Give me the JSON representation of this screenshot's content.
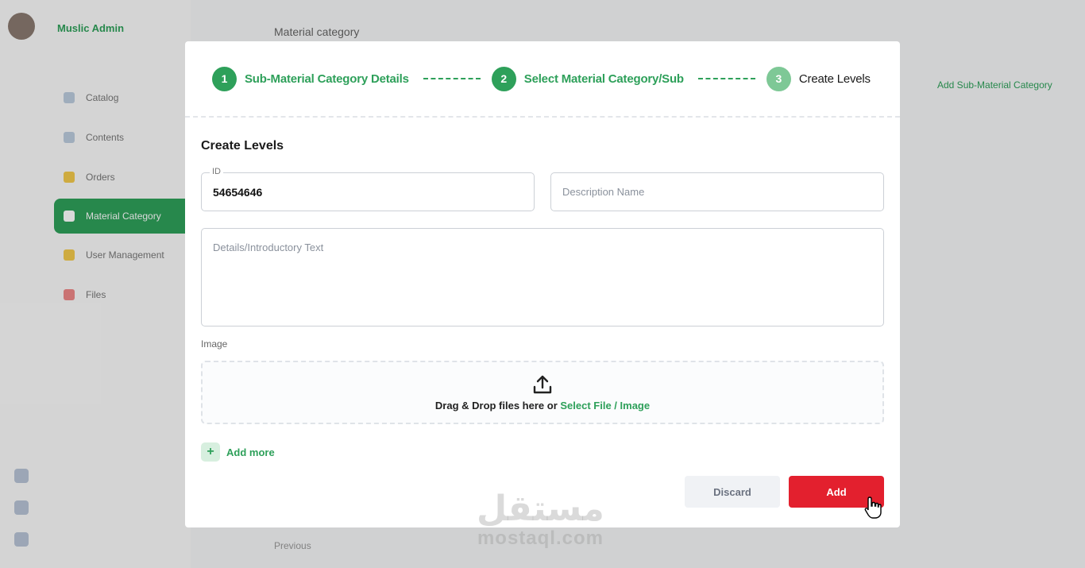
{
  "background": {
    "brand": "Muslic Admin",
    "page_title": "Material category",
    "nav_items": [
      "Catalog",
      "Contents",
      "Orders",
      "Material Category",
      "User Management",
      "Files"
    ],
    "right_link": "Add Sub-Material Category",
    "bottom_text": "Previous"
  },
  "stepper": {
    "steps": [
      {
        "num": "1",
        "label": "Sub-Material Category Details"
      },
      {
        "num": "2",
        "label": "Select Material Category/Sub"
      },
      {
        "num": "3",
        "label": "Create Levels"
      }
    ]
  },
  "form": {
    "section_title": "Create Levels",
    "id_label": "ID",
    "id_value": "54654646",
    "description_placeholder": "Description Name",
    "details_placeholder": "Details/Introductory Text",
    "image_label": "Image",
    "dropzone_text": "Drag & Drop files here or",
    "dropzone_link": "Select File / Image",
    "add_more_label": "Add more"
  },
  "actions": {
    "discard_label": "Discard",
    "add_label": "Add"
  },
  "watermark": {
    "arabic": "مستقل",
    "latin": "mostaql.com"
  },
  "colors": {
    "accent": "#2ea05a",
    "danger": "#e3202e"
  }
}
